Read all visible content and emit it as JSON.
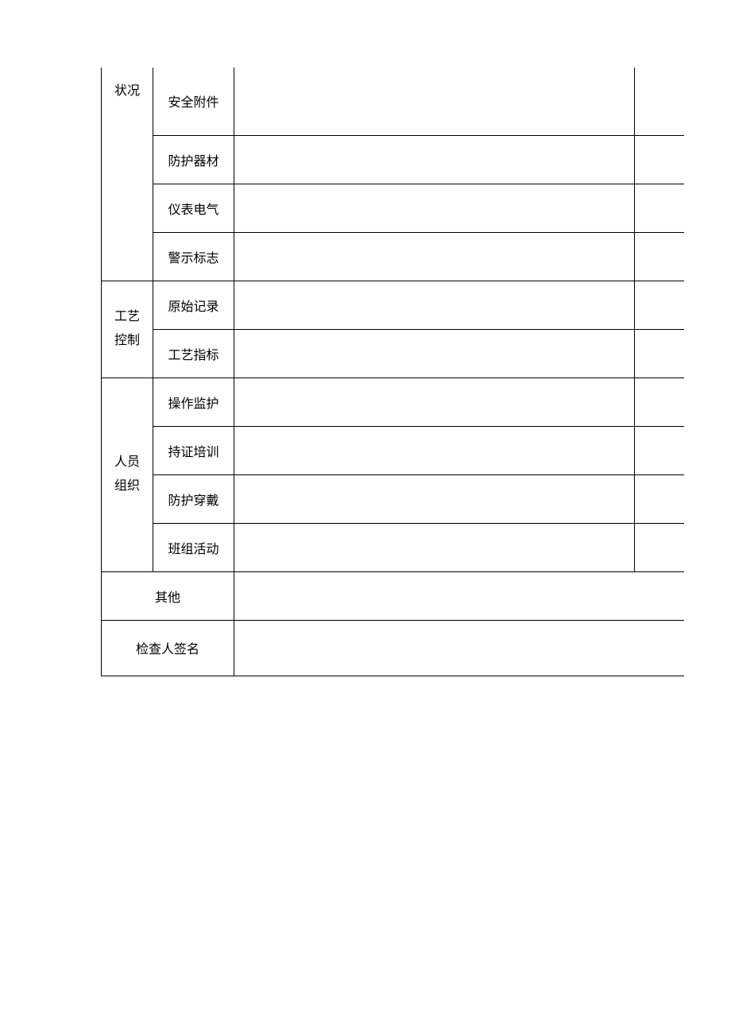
{
  "sections": {
    "status": {
      "label": "状况",
      "items": [
        "安全附件",
        "防护器材",
        "仪表电气",
        "警示标志"
      ]
    },
    "process": {
      "label_line1": "工艺",
      "label_line2": "控制",
      "items": [
        "原始记录",
        "工艺指标"
      ]
    },
    "personnel": {
      "label_line1": "人员",
      "label_line2": "组织",
      "items": [
        "操作监护",
        "持证培训",
        "防护穿戴",
        "班组活动"
      ]
    },
    "other": {
      "label": "其他"
    },
    "signature": {
      "label": "检查人签名"
    }
  }
}
